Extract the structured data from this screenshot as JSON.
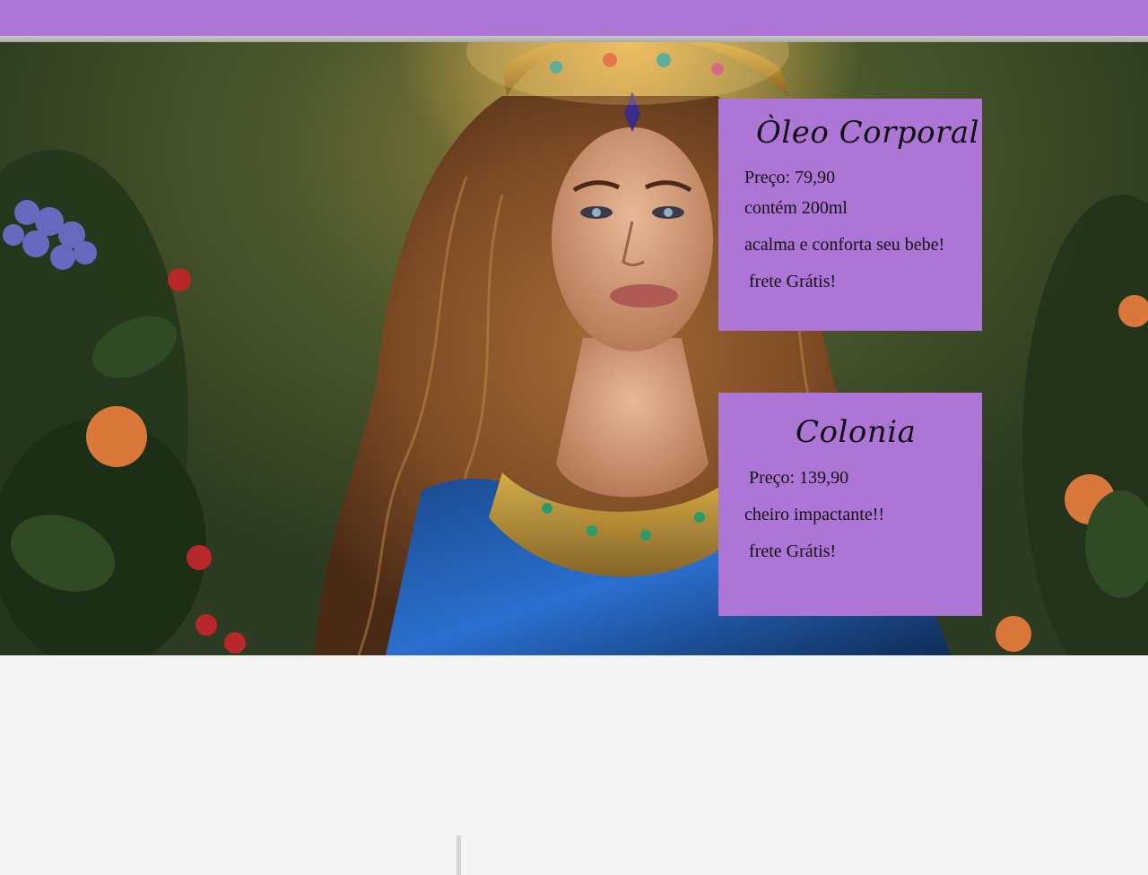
{
  "products": [
    {
      "title": "Òleo Corporal",
      "lines": [
        "Preço: 79,90",
        "contém 200ml",
        "acalma e conforta seu bebe!",
        " frete Grátis!"
      ]
    },
    {
      "title": "Colonia",
      "lines": [
        " Preço: 139,90",
        "cheiro impactante!!",
        " frete Grátis!"
      ]
    }
  ],
  "colors": {
    "accent": "#ad76d6",
    "page_background": "#f4f4f4"
  },
  "hero": {
    "image": "woman-with-jeweled-crown-among-flowers"
  }
}
